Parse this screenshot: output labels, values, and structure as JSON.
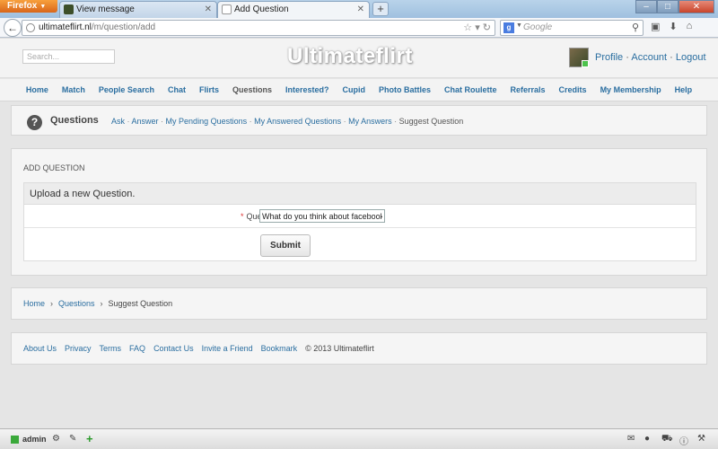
{
  "browser": {
    "app_button": "Firefox",
    "tabs": [
      {
        "label": "View message"
      },
      {
        "label": "Add Question"
      }
    ],
    "new_tab": "+",
    "url_host": "ultimateflirt.nl",
    "url_path": "/m/question/add",
    "search_engine": "g",
    "search_placeholder": "Google"
  },
  "site": {
    "logo": "Ultimateflirt",
    "search_placeholder": "Search...",
    "user_links": [
      "Profile",
      "Account",
      "Logout"
    ],
    "nav": [
      "Home",
      "Match",
      "People Search",
      "Chat",
      "Flirts",
      "Questions",
      "Interested?",
      "Cupid",
      "Photo Battles",
      "Chat Roulette",
      "Referrals",
      "Credits",
      "My Membership",
      "Help"
    ],
    "nav_active": "Questions"
  },
  "questions": {
    "icon": "?",
    "title": "Questions",
    "subnav": [
      "Ask",
      "Answer",
      "My Pending Questions",
      "My Answered Questions",
      "My Answers"
    ],
    "current": "Suggest Question"
  },
  "form": {
    "heading": "ADD QUESTION",
    "box_title": "Upload a new Question.",
    "required_mark": "*",
    "question_label": "Question:",
    "question_value": "What do you think about facebook new",
    "submit_label": "Submit"
  },
  "breadcrumb": {
    "items": [
      "Home",
      "Questions"
    ],
    "current": "Suggest Question",
    "separator": "›"
  },
  "footer": {
    "links": [
      "About Us",
      "Privacy",
      "Terms",
      "FAQ",
      "Contact Us",
      "Invite a Friend",
      "Bookmark"
    ],
    "copyright": "© 2013 Ultimateflirt"
  },
  "bottombar": {
    "user_label": "admin"
  },
  "colors": {
    "link": "#2a6ea0",
    "accent_green": "#3aa93a",
    "firefox_orange": "#e07a26"
  }
}
